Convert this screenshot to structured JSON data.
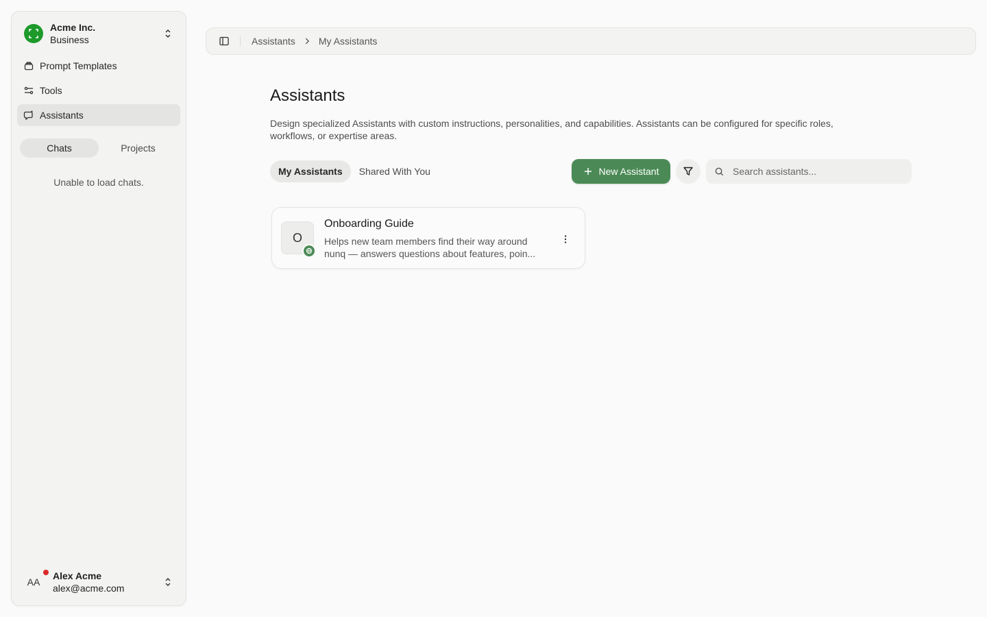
{
  "org": {
    "name": "Acme Inc.",
    "plan": "Business",
    "logo_color": "#1d9a2a"
  },
  "sidebar": {
    "items": [
      {
        "label": "Prompt Templates",
        "icon": "prompt-template-icon"
      },
      {
        "label": "Tools",
        "icon": "tools-icon"
      },
      {
        "label": "Assistants",
        "icon": "assistant-icon",
        "active": true
      }
    ],
    "segments": {
      "chats": "Chats",
      "projects": "Projects",
      "active": "Chats"
    },
    "empty_message": "Unable to load chats."
  },
  "user": {
    "initials": "AA",
    "name": "Alex Acme",
    "email": "alex@acme.com",
    "status_color": "#dc2a2a"
  },
  "breadcrumb": {
    "parent": "Assistants",
    "current": "My Assistants"
  },
  "page": {
    "title": "Assistants",
    "description": "Design specialized Assistants with custom instructions, personalities, and capabilities. Assistants can be configured for specific roles, workflows, or expertise areas."
  },
  "tabs": {
    "mine": "My Assistants",
    "shared": "Shared With You",
    "active": "My Assistants"
  },
  "actions": {
    "new_label": "New Assistant",
    "accent": "#4b8a56"
  },
  "search": {
    "placeholder": "Search assistants...",
    "value": ""
  },
  "assistants": [
    {
      "initial": "O",
      "name": "Onboarding Guide",
      "description": "Helps new team members find their way around nunq — answers questions about features, poin...",
      "badge_icon": "globe-icon"
    }
  ]
}
